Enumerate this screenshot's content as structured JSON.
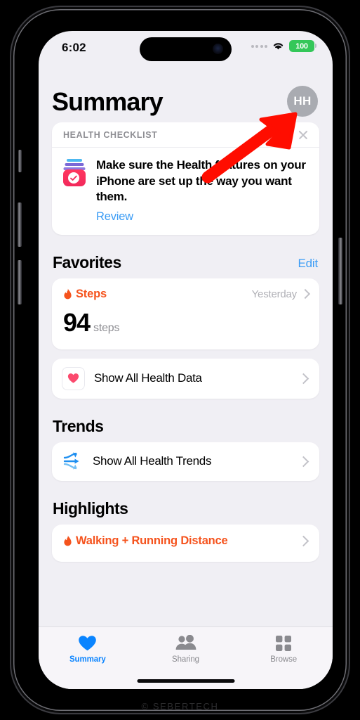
{
  "status_bar": {
    "time": "6:02",
    "cellular_icon": "signal-dots-icon",
    "wifi_icon": "wifi-icon",
    "battery_level": "100"
  },
  "header": {
    "title": "Summary",
    "avatar_initials": "HH"
  },
  "checklist": {
    "kicker": "HEALTH CHECKLIST",
    "close_icon": "close-icon",
    "icon": "health-checklist-icon",
    "message": "Make sure the Health features on your iPhone are set up the way you want them.",
    "link_label": "Review"
  },
  "favorites": {
    "title": "Favorites",
    "edit_label": "Edit",
    "steps": {
      "icon": "flame-icon",
      "name": "Steps",
      "timestamp": "Yesterday",
      "value": "94",
      "unit": "steps"
    },
    "all_data_row": {
      "icon": "heart-icon",
      "label": "Show All Health Data"
    }
  },
  "trends": {
    "title": "Trends",
    "row": {
      "icon": "trends-arrows-icon",
      "label": "Show All Health Trends"
    }
  },
  "highlights": {
    "title": "Highlights",
    "row": {
      "icon": "flame-icon",
      "label": "Walking + Running Distance"
    }
  },
  "tab_bar": {
    "tabs": [
      {
        "label": "Summary",
        "icon": "heart-icon",
        "active": true
      },
      {
        "label": "Sharing",
        "icon": "people-icon",
        "active": false
      },
      {
        "label": "Browse",
        "icon": "grid-icon",
        "active": false
      }
    ]
  },
  "annotation": {
    "arrow_color": "#ff0d00",
    "points_to": "avatar"
  },
  "watermark": "© SEBERTECH",
  "colors": {
    "accent_blue": "#3b9cf5",
    "tab_active_blue": "#0a84ff",
    "steps_orange": "#f5531d",
    "battery_green": "#34c759",
    "screen_background": "#f0eff4",
    "card_white": "#ffffff"
  }
}
